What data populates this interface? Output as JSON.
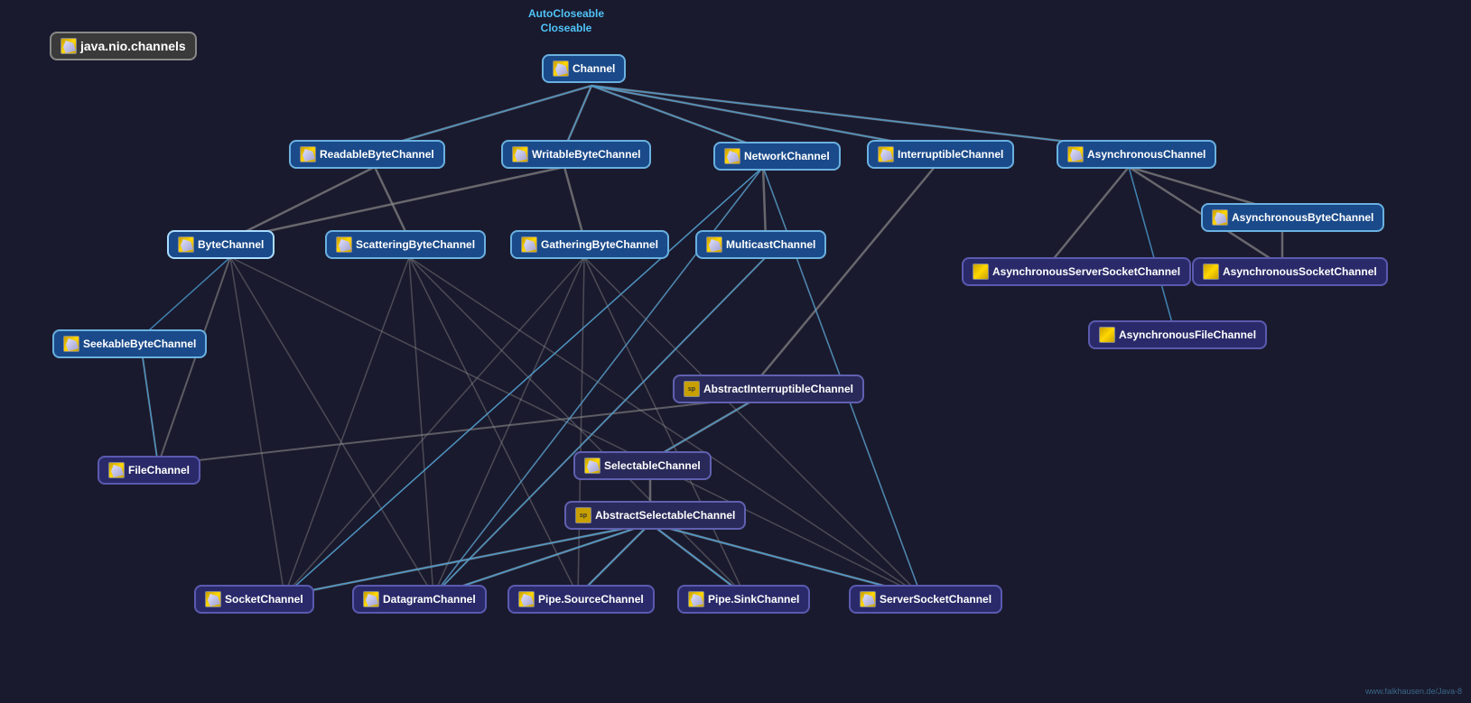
{
  "diagram": {
    "title": "java.nio.channels",
    "watermark": "www.falkhausen.de/Java-8",
    "nodes": {
      "package_label": "java.nio.channels",
      "channel_parents": "AutoCloseable\nCloseable",
      "channel": "Channel",
      "readable_byte_channel": "ReadableByteChannel",
      "writable_byte_channel": "WritableByteChannel",
      "network_channel": "NetworkChannel",
      "interruptible_channel": "InterruptibleChannel",
      "asynchronous_channel": "AsynchronousChannel",
      "byte_channel": "ByteChannel",
      "scattering_byte_channel": "ScatteringByteChannel",
      "gathering_byte_channel": "GatheringByteChannel",
      "multicast_channel": "MulticastChannel",
      "asynchronous_byte_channel": "AsynchronousByteChannel",
      "asynchronous_server_socket_channel": "AsynchronousServerSocketChannel",
      "asynchronous_socket_channel": "AsynchronousSocketChannel",
      "seekable_byte_channel": "SeekableByteChannel",
      "file_channel": "FileChannel",
      "abstract_interruptible_channel": "AbstractInterruptibleChannel",
      "selectable_channel": "SelectableChannel",
      "abstract_selectable_channel": "AbstractSelectableChannel",
      "asynchronous_file_channel": "AsynchronousFileChannel",
      "socket_channel": "SocketChannel",
      "datagram_channel": "DatagramChannel",
      "pipe_source_channel": "Pipe.SourceChannel",
      "pipe_sink_channel": "Pipe.SinkChannel",
      "server_socket_channel": "ServerSocketChannel"
    }
  }
}
